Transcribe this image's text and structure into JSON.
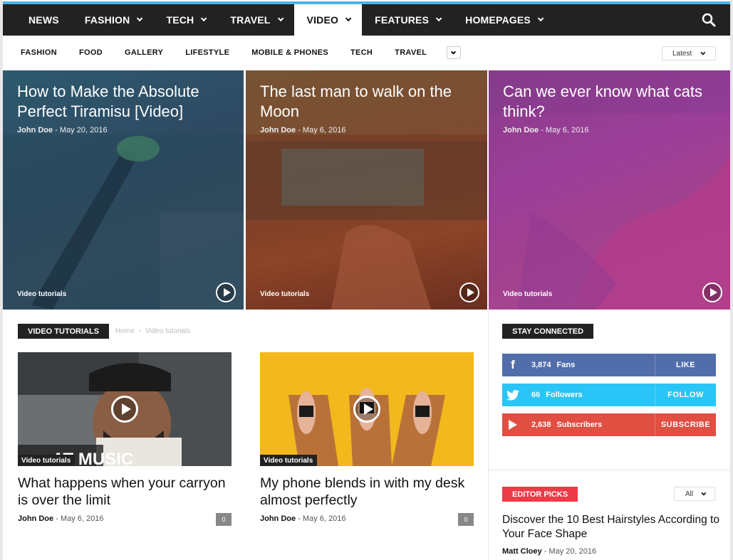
{
  "main_nav": {
    "items": [
      {
        "label": "NEWS",
        "dropdown": false
      },
      {
        "label": "FASHION",
        "dropdown": true
      },
      {
        "label": "TECH",
        "dropdown": true
      },
      {
        "label": "TRAVEL",
        "dropdown": true
      },
      {
        "label": "VIDEO",
        "dropdown": true,
        "active": true
      },
      {
        "label": "FEATURES",
        "dropdown": true
      },
      {
        "label": "HOMEPAGES",
        "dropdown": true
      }
    ],
    "search_icon": "search-icon"
  },
  "sub_nav": {
    "items": [
      "FASHION",
      "FOOD",
      "GALLERY",
      "LIFESTYLE",
      "MOBILE & PHONES",
      "TECH",
      "TRAVEL"
    ],
    "sort_label": "Latest"
  },
  "hero": [
    {
      "title": "How to Make the Absolute Perfect Tiramisu [Video]",
      "author": "John Doe",
      "sep": "-",
      "date": "May 20, 2016",
      "category": "Video tutorials"
    },
    {
      "title": "The last man to walk on the Moon",
      "author": "John Doe",
      "sep": "-",
      "date": "May 6, 2016",
      "category": "Video tutorials"
    },
    {
      "title": "Can we ever know what cats think?",
      "author": "John Doe",
      "sep": "-",
      "date": "May 6, 2016",
      "category": "Video tutorials"
    }
  ],
  "section": {
    "title": "VIDEO TUTORIALS",
    "breadcrumb": [
      "Home",
      "›",
      "Video tutorials"
    ]
  },
  "cards": [
    {
      "title": "What happens when your carryon is over the limit",
      "author": "John Doe",
      "sep": "-",
      "date": "May 6, 2016",
      "category": "Video tutorials",
      "comments": "0",
      "thumb_text": "AT MUSIC"
    },
    {
      "title": "My phone blends in with my desk almost perfectly",
      "author": "John Doe",
      "sep": "-",
      "date": "May 6, 2016",
      "category": "Video tutorials",
      "comments": "0"
    }
  ],
  "sidebar": {
    "stay_connected": "STAY CONNECTED",
    "social": [
      {
        "icon": "facebook-icon",
        "count": "3,874",
        "label": "Fans",
        "action": "LIKE",
        "color": "#516eab"
      },
      {
        "icon": "twitter-icon",
        "count": "66",
        "label": "Followers",
        "action": "FOLLOW",
        "color": "#29c5f6"
      },
      {
        "icon": "youtube-icon",
        "count": "2,638",
        "label": "Subscribers",
        "action": "SUBSCRIBE",
        "color": "#e14e42"
      }
    ],
    "editor_picks": "EDITOR PICKS",
    "filter_label": "All",
    "pick": {
      "title": "Discover the 10 Best Hairstyles According to Your Face Shape",
      "author": "Matt Cloey",
      "sep": "-",
      "date": "May 20, 2016"
    }
  },
  "colors": {
    "accent": "#4db2ec",
    "dark": "#222222",
    "red": "#ee3a46"
  }
}
